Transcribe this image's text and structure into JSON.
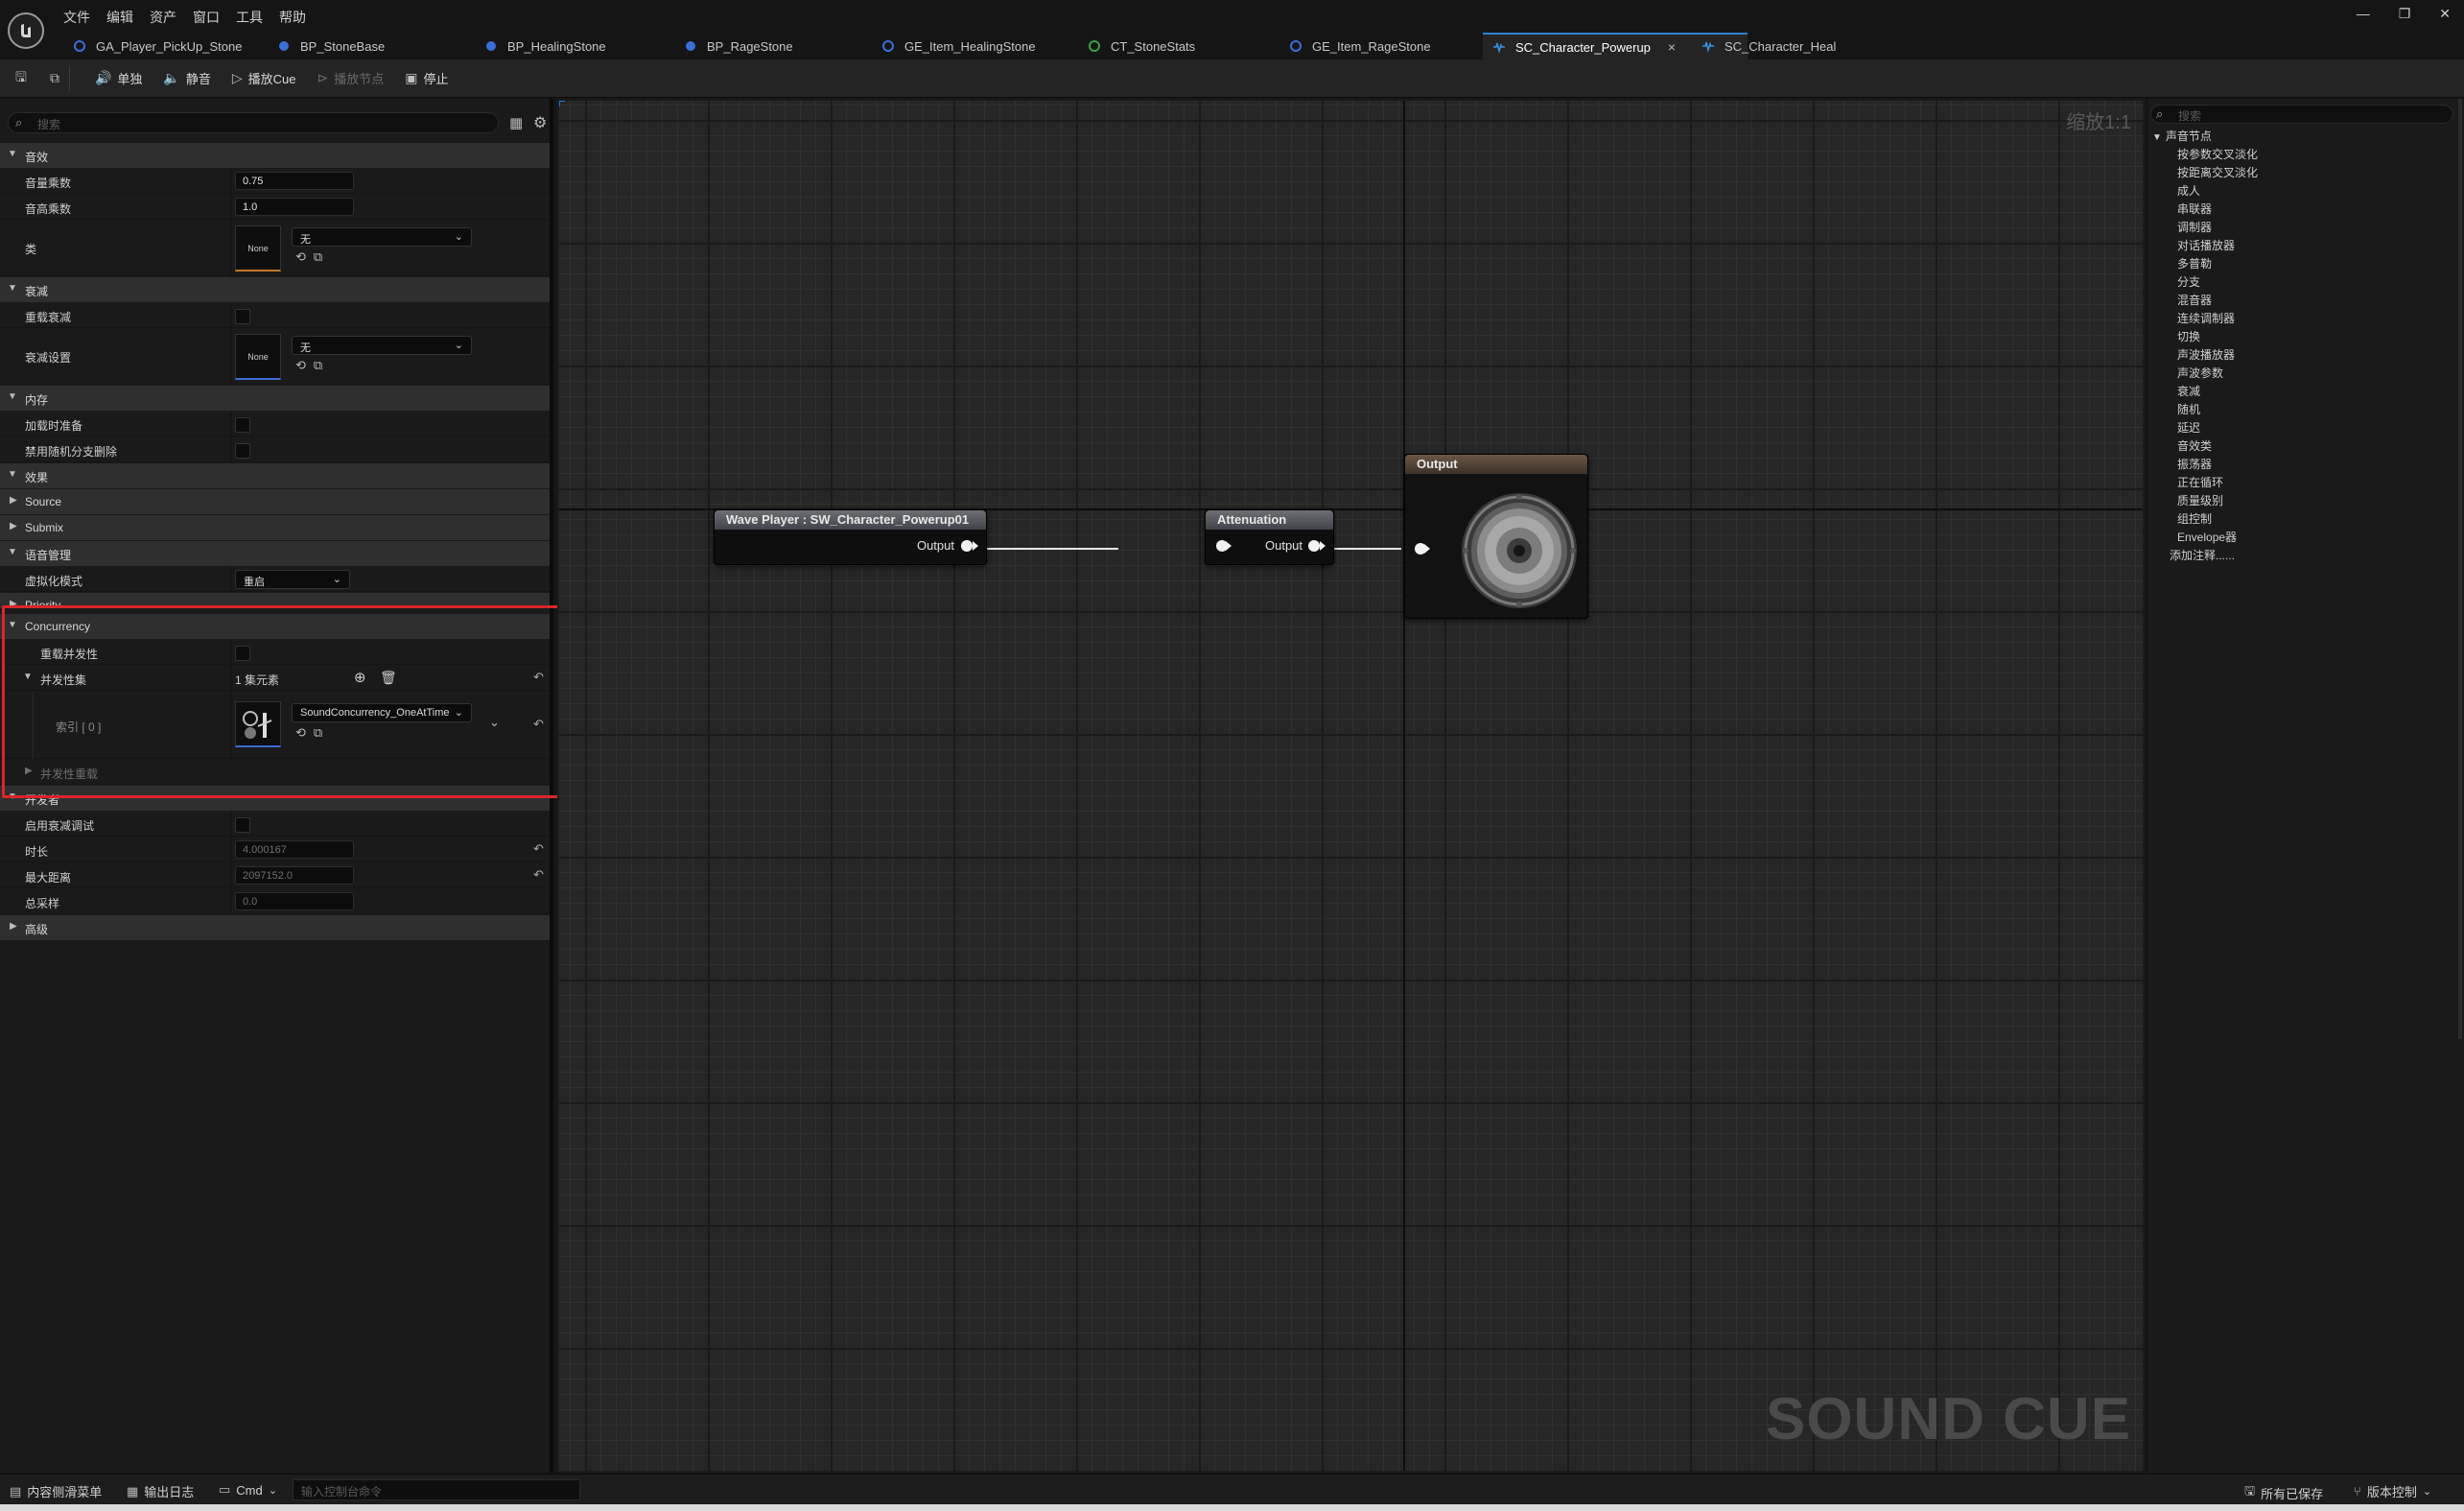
{
  "menu": [
    "文件",
    "编辑",
    "资产",
    "窗口",
    "工具",
    "帮助"
  ],
  "tabs": [
    {
      "label": "GA_Player_PickUp_Stone",
      "color": "#3a6fd8"
    },
    {
      "label": "BP_StoneBase",
      "color": "#3a6fd8"
    },
    {
      "label": "BP_HealingStone",
      "color": "#3a6fd8"
    },
    {
      "label": "BP_RageStone",
      "color": "#3a6fd8"
    },
    {
      "label": "GE_Item_HealingStone",
      "color": "#3a6fd8"
    },
    {
      "label": "CT_StoneStats",
      "color": "#3aa04a"
    },
    {
      "label": "GE_Item_RageStone",
      "color": "#3a6fd8"
    },
    {
      "label": "SC_Character_Powerup",
      "color": "#3a90e0",
      "close": "×"
    },
    {
      "label": "SC_Character_Heal",
      "color": "#3a90e0"
    }
  ],
  "window_controls": {
    "minimize": "—",
    "restore": "❐",
    "close": "✕"
  },
  "toolbar": {
    "solo": "单独",
    "mute": "静音",
    "play_cue": "播放Cue",
    "play_node": "播放节点",
    "stop": "停止"
  },
  "details": {
    "search_placeholder": "搜索",
    "categories": {
      "sound": "音效",
      "attenuation": "衰减",
      "memory": "内存",
      "effects": "效果",
      "source": "Source",
      "submix": "Submix",
      "voice_mgmt": "语音管理",
      "priority": "Priority",
      "concurrency": "Concurrency",
      "developer": "开发者",
      "advanced": "高级"
    },
    "props": {
      "volume_label": "音量乘数",
      "volume_value": "0.75",
      "pitch_label": "音高乘数",
      "pitch_value": "1.0",
      "class_label": "类",
      "class_value": "无",
      "class_thumb": "None",
      "override_att_label": "重载衰减",
      "att_settings_label": "衰减设置",
      "att_settings_value": "无",
      "att_thumb": "None",
      "load_prime_label": "加载时准备",
      "disable_random_label": "禁用随机分支删除",
      "virtualization_label": "虚拟化模式",
      "virtualization_value": "重启",
      "override_conc_label": "重载并发性",
      "conc_set_label": "并发性集",
      "conc_set_value": "1 集元素",
      "index_label": "索引 [ 0 ]",
      "index_value": "SoundConcurrency_OneAtTime",
      "conc_override_label": "并发性重载",
      "debug_att_label": "启用衰减调试",
      "duration_label": "时长",
      "duration_value": "4.000167",
      "max_distance_label": "最大距离",
      "max_distance_value": "2097152.0",
      "total_samples_label": "总采样",
      "total_samples_value": "0.0"
    }
  },
  "graph": {
    "zoom": "缩放1:1",
    "watermark": "SOUND CUE",
    "nodes": {
      "wave_player": {
        "title": "Wave Player : SW_Character_Powerup01",
        "output": "Output"
      },
      "attenuation": {
        "title": "Attenuation",
        "output": "Output"
      },
      "output": {
        "title": "Output"
      }
    }
  },
  "palette": {
    "search_placeholder": "搜索",
    "category": "声音节点",
    "items": [
      "按参数交叉淡化",
      "按距离交叉淡化",
      "成人",
      "串联器",
      "调制器",
      "对话播放器",
      "多普勒",
      "分支",
      "混音器",
      "连续调制器",
      "切换",
      "声波播放器",
      "声波参数",
      "衰减",
      "随机",
      "延迟",
      "音效类",
      "振荡器",
      "正在循环",
      "质量级别",
      "组控制",
      "Envelope器"
    ],
    "footer": "添加注释......"
  },
  "statusbar": {
    "content_drawer": "内容侧滑菜单",
    "output_log": "输出日志",
    "cmd": "Cmd",
    "cmd_placeholder": "输入控制台命令",
    "all_saved": "所有已保存",
    "source_control": "版本控制"
  }
}
